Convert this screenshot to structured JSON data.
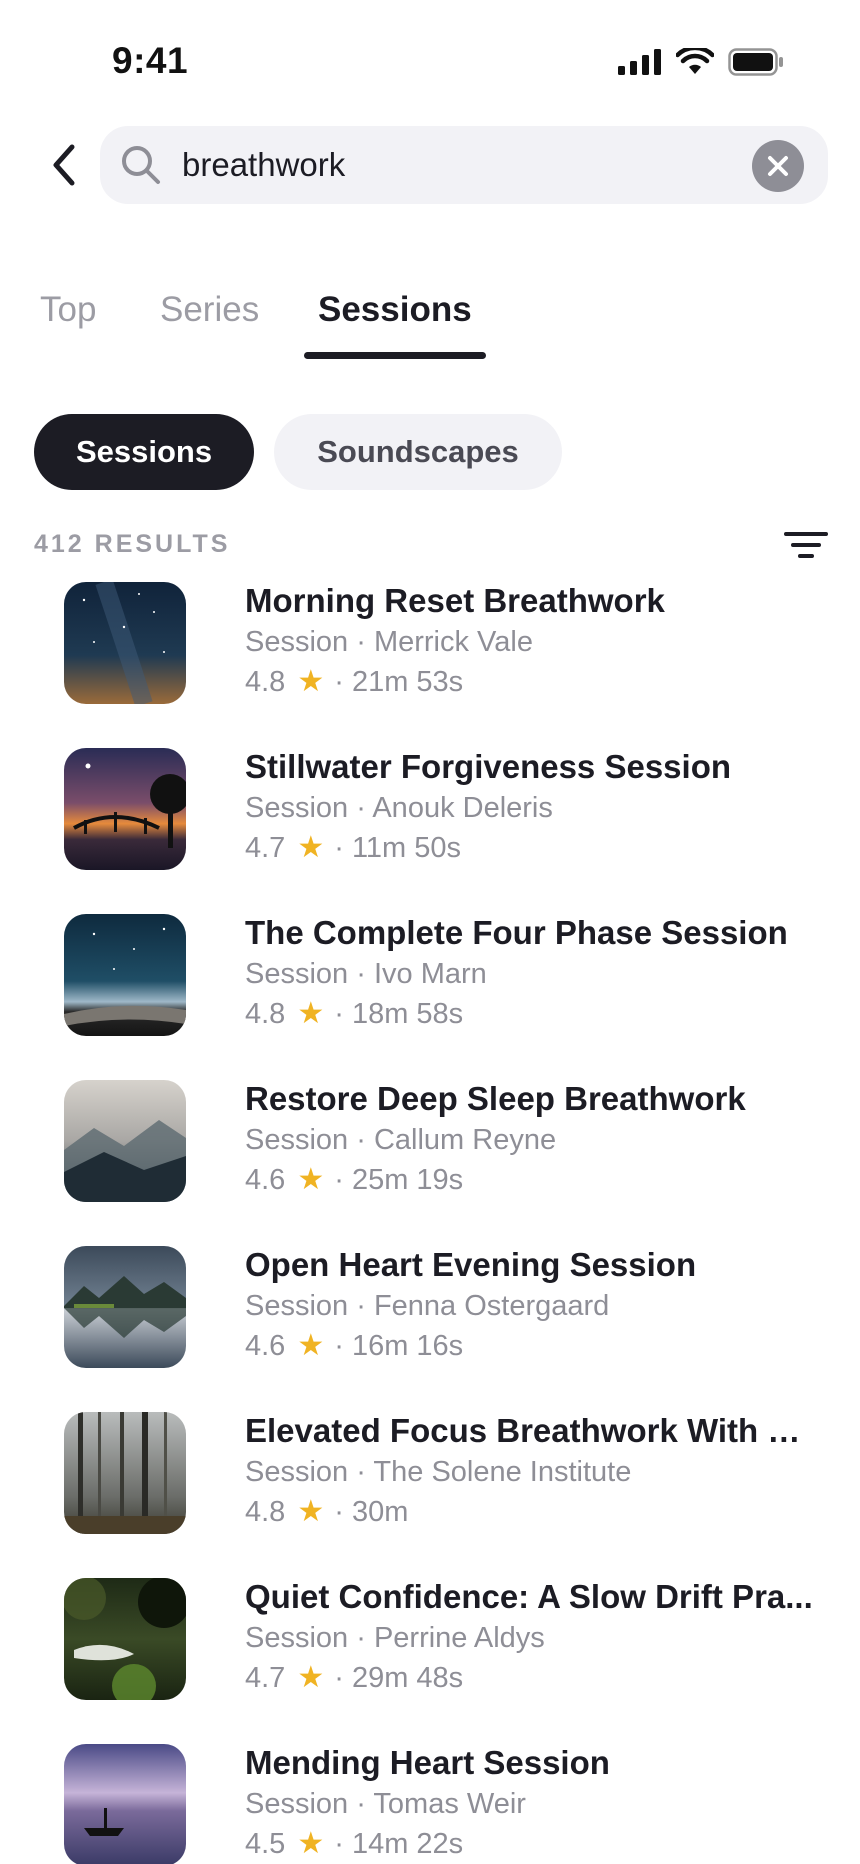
{
  "status_bar": {
    "time": "9:41"
  },
  "search": {
    "query": "breathwork"
  },
  "tabs": [
    {
      "label": "Top"
    },
    {
      "label": "Series"
    },
    {
      "label": "Sessions"
    }
  ],
  "chips": [
    {
      "label": "Sessions"
    },
    {
      "label": "Soundscapes"
    }
  ],
  "results": {
    "count_label": "412 RESULTS",
    "items": [
      {
        "title": "Morning Reset Breathwork",
        "type": "Session",
        "author": "Merrick Vale",
        "rating": "4.8",
        "duration": "21m 53s",
        "thumbnail": "starry-night-sky"
      },
      {
        "title": "Stillwater Forgiveness Session",
        "type": "Session",
        "author": "Anouk Deleris",
        "rating": "4.7",
        "duration": "11m 50s",
        "thumbnail": "sunset-bridge"
      },
      {
        "title": "The Complete Four Phase Session",
        "type": "Session",
        "author": "Ivo Marn",
        "rating": "4.8",
        "duration": "18m 58s",
        "thumbnail": "night-road-stars"
      },
      {
        "title": "Restore Deep Sleep Breathwork",
        "type": "Session",
        "author": "Callum Reyne",
        "rating": "4.6",
        "duration": "25m 19s",
        "thumbnail": "misty-forest-hills"
      },
      {
        "title": "Open Heart Evening Session",
        "type": "Session",
        "author": "Fenna Ostergaard",
        "rating": "4.6",
        "duration": "16m 16s",
        "thumbnail": "lake-reflection"
      },
      {
        "title": "Elevated Focus Breathwork With G...",
        "type": "Session",
        "author": "The Solene Institute",
        "rating": "4.8",
        "duration": "30m",
        "thumbnail": "foggy-forest"
      },
      {
        "title": "Quiet Confidence: A Slow Drift Pra...",
        "type": "Session",
        "author": "Perrine Aldys",
        "rating": "4.7",
        "duration": "29m 48s",
        "thumbnail": "forest-stream"
      },
      {
        "title": "Mending Heart Session",
        "type": "Session",
        "author": "Tomas Weir",
        "rating": "4.5",
        "duration": "14m 22s",
        "thumbnail": "purple-lake-boat"
      }
    ]
  },
  "colors": {
    "accent": "#1c1c24",
    "muted": "#8e8e96",
    "star": "#f0b323",
    "chip_bg": "#f2f2f6"
  }
}
